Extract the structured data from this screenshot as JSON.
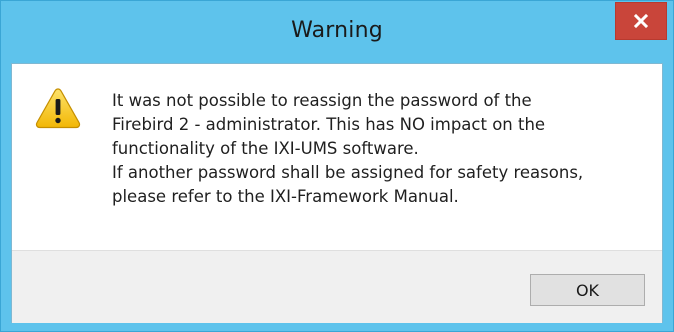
{
  "dialog": {
    "title": "Warning",
    "close_label": "x",
    "icon": "warning-icon",
    "message_lines": [
      "It was not possible to reassign the password of the",
      "Firebird 2 - administrator. This has NO impact on the",
      "functionality of the IXI-UMS software.",
      "If another password shall be assigned for safety reasons,",
      "please refer to the IXI-Framework Manual."
    ],
    "ok_label": "OK"
  },
  "colors": {
    "frame": "#5ec3ec",
    "close_button": "#c9453a",
    "warning_fill": "#f5c518",
    "button_bar": "#f0f0f0"
  }
}
